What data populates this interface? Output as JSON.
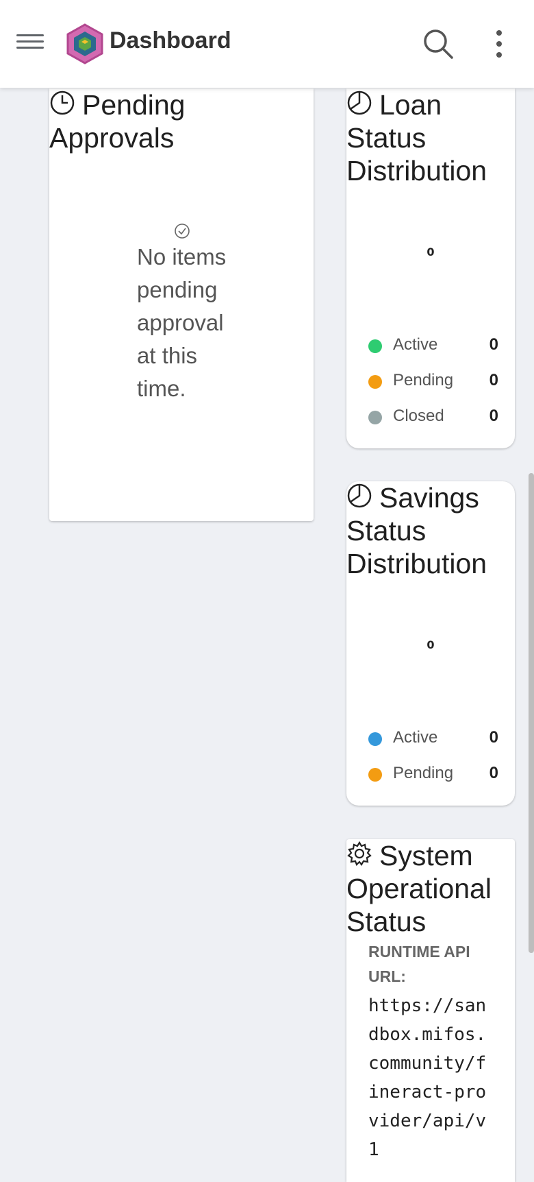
{
  "header": {
    "title": "Dashboard",
    "menu_icon": "hamburger-menu-icon",
    "search_icon": "search-icon",
    "more_icon": "more-vertical-icon"
  },
  "pending_approvals": {
    "title": "Pending Approvals",
    "icon": "clock-icon",
    "empty_icon": "check-circle-icon",
    "empty_message": "No items pending approval at this time."
  },
  "loan_status": {
    "title": "Loan Status Distribution",
    "icon": "pie-chart-icon",
    "total": "0",
    "legend": [
      {
        "label": "Active",
        "value": "0",
        "color": "#2ecc71"
      },
      {
        "label": "Pending",
        "value": "0",
        "color": "#f39c12"
      },
      {
        "label": "Closed",
        "value": "0",
        "color": "#95a5a6"
      }
    ]
  },
  "savings_status": {
    "title": "Savings Status Distribution",
    "icon": "pie-chart-icon",
    "total": "0",
    "legend": [
      {
        "label": "Active",
        "value": "0",
        "color": "#3498db"
      },
      {
        "label": "Pending",
        "value": "0",
        "color": "#f39c12"
      }
    ]
  },
  "system_status": {
    "title": "System Operational Status",
    "icon": "gear-icon",
    "runtime_label": "RUNTIME API URL:",
    "runtime_url": "https://sandbox.mifos.community/fineract-provider/api/v1"
  }
}
